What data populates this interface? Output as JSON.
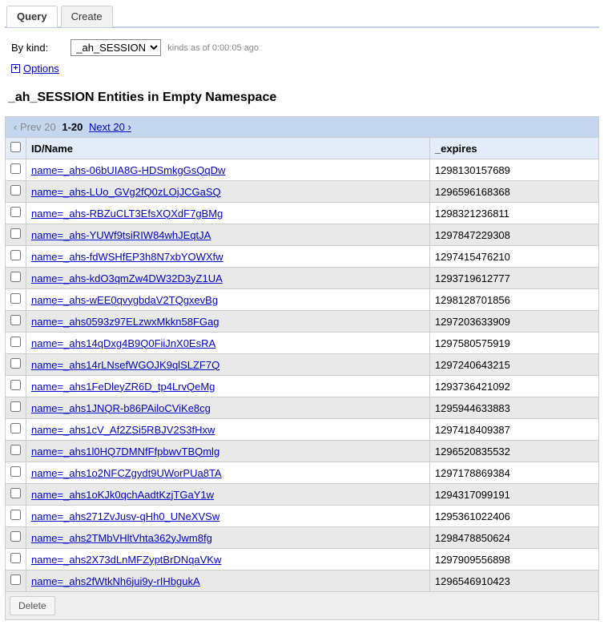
{
  "tabs": {
    "query": "Query",
    "create": "Create"
  },
  "query": {
    "kind_label": "By kind:",
    "kind_value": "_ah_SESSION",
    "kinds_meta": "kinds as of 0:00:05 ago",
    "options_label": "Options"
  },
  "heading": "_ah_SESSION Entities in Empty Namespace",
  "pager": {
    "prev": "‹ Prev 20",
    "range": "1-20",
    "next": "Next 20 ›"
  },
  "columns": {
    "id": "ID/Name",
    "expires": "_expires"
  },
  "rows": [
    {
      "id": "name=_ahs-06bUIA8G-HDSmkgGsQqDw",
      "expires": "1298130157689"
    },
    {
      "id": "name=_ahs-LUo_GVg2fQ0zLOjJCGaSQ",
      "expires": "1296596168368"
    },
    {
      "id": "name=_ahs-RBZuCLT3EfsXQXdF7gBMg",
      "expires": "1298321236811"
    },
    {
      "id": "name=_ahs-YUWf9tsiRIW84whJEqtJA",
      "expires": "1297847229308"
    },
    {
      "id": "name=_ahs-fdWSHfEP3h8N7xbYOWXfw",
      "expires": "1297415476210"
    },
    {
      "id": "name=_ahs-kdO3qmZw4DW32D3yZ1UA",
      "expires": "1293719612777"
    },
    {
      "id": "name=_ahs-wEE0qvygbdaV2TQgxevBg",
      "expires": "1298128701856"
    },
    {
      "id": "name=_ahs0593z97ELzwxMkkn58FGag",
      "expires": "1297203633909"
    },
    {
      "id": "name=_ahs14qDxg4B9Q0FiiJnX0EsRA",
      "expires": "1297580575919"
    },
    {
      "id": "name=_ahs14rLNsefWGOJK9qlSLZF7Q",
      "expires": "1297240643215"
    },
    {
      "id": "name=_ahs1FeDleyZR6D_tp4LrvQeMg",
      "expires": "1293736421092"
    },
    {
      "id": "name=_ahs1JNQR-b86PAiloCViKe8cg",
      "expires": "1295944633883"
    },
    {
      "id": "name=_ahs1cV_Af2ZSi5RBJV2S3fHxw",
      "expires": "1297418409387"
    },
    {
      "id": "name=_ahs1l0HQ7DMNfFfpbwvTBQmlg",
      "expires": "1296520835532"
    },
    {
      "id": "name=_ahs1o2NFCZgydt9UWorPUa8TA",
      "expires": "1297178869384"
    },
    {
      "id": "name=_ahs1oKJk0qchAadtKzjTGaY1w",
      "expires": "1294317099191"
    },
    {
      "id": "name=_ahs271ZvJusv-qHh0_UNeXVSw",
      "expires": "1295361022406"
    },
    {
      "id": "name=_ahs2TMbVHltVhta362yJwm8fg",
      "expires": "1298478850624"
    },
    {
      "id": "name=_ahs2X73dLnMFZyptBrDNqaVKw",
      "expires": "1297909556898"
    },
    {
      "id": "name=_ahs2fWtkNh6jui9y-rIHbgukA",
      "expires": "1296546910423"
    }
  ],
  "footer": {
    "delete": "Delete"
  }
}
